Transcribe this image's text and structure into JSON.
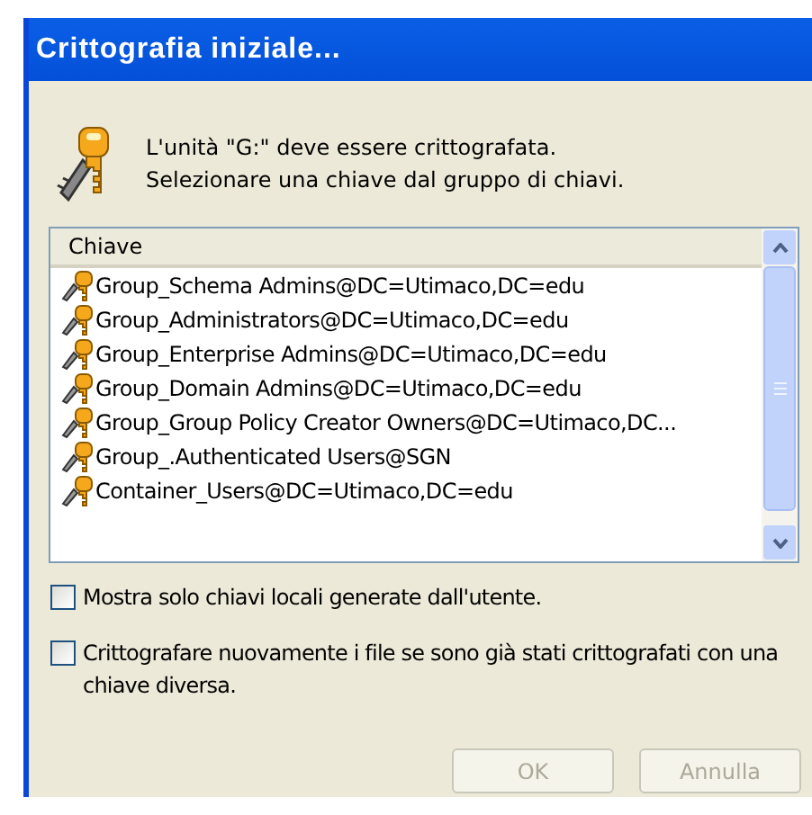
{
  "window": {
    "title": "Crittografia iniziale..."
  },
  "message": [
    "L'unità \"G:\" deve essere crittografata.",
    "Selezionare una chiave dal gruppo di chiavi."
  ],
  "key_list": {
    "columns": [
      "Chiave"
    ],
    "rows": [
      {
        "label": "Group_Schema Admins@DC=Utimaco,DC=edu",
        "selected": false
      },
      {
        "label": "Group_Administrators@DC=Utimaco,DC=edu",
        "selected": false
      },
      {
        "label": "Group_Enterprise Admins@DC=Utimaco,DC=edu",
        "selected": false
      },
      {
        "label": "Group_Domain Admins@DC=Utimaco,DC=edu",
        "selected": false
      },
      {
        "label": "Group_Group Policy Creator Owners@DC=Utimaco,DC...",
        "selected": false
      },
      {
        "label": "Group_.Authenticated Users@SGN",
        "selected": false
      },
      {
        "label": "Container_Users@DC=Utimaco,DC=edu",
        "selected": false
      }
    ]
  },
  "options": [
    {
      "label": "Mostra solo chiavi locali generate dall'utente.",
      "checked": false
    },
    {
      "label": "Crittografare nuovamente i file se sono già stati crittografati con una chiave diversa.",
      "checked": false
    }
  ],
  "buttons": [
    {
      "label": "OK",
      "disabled": true
    },
    {
      "label": "Annulla",
      "disabled": true
    }
  ]
}
